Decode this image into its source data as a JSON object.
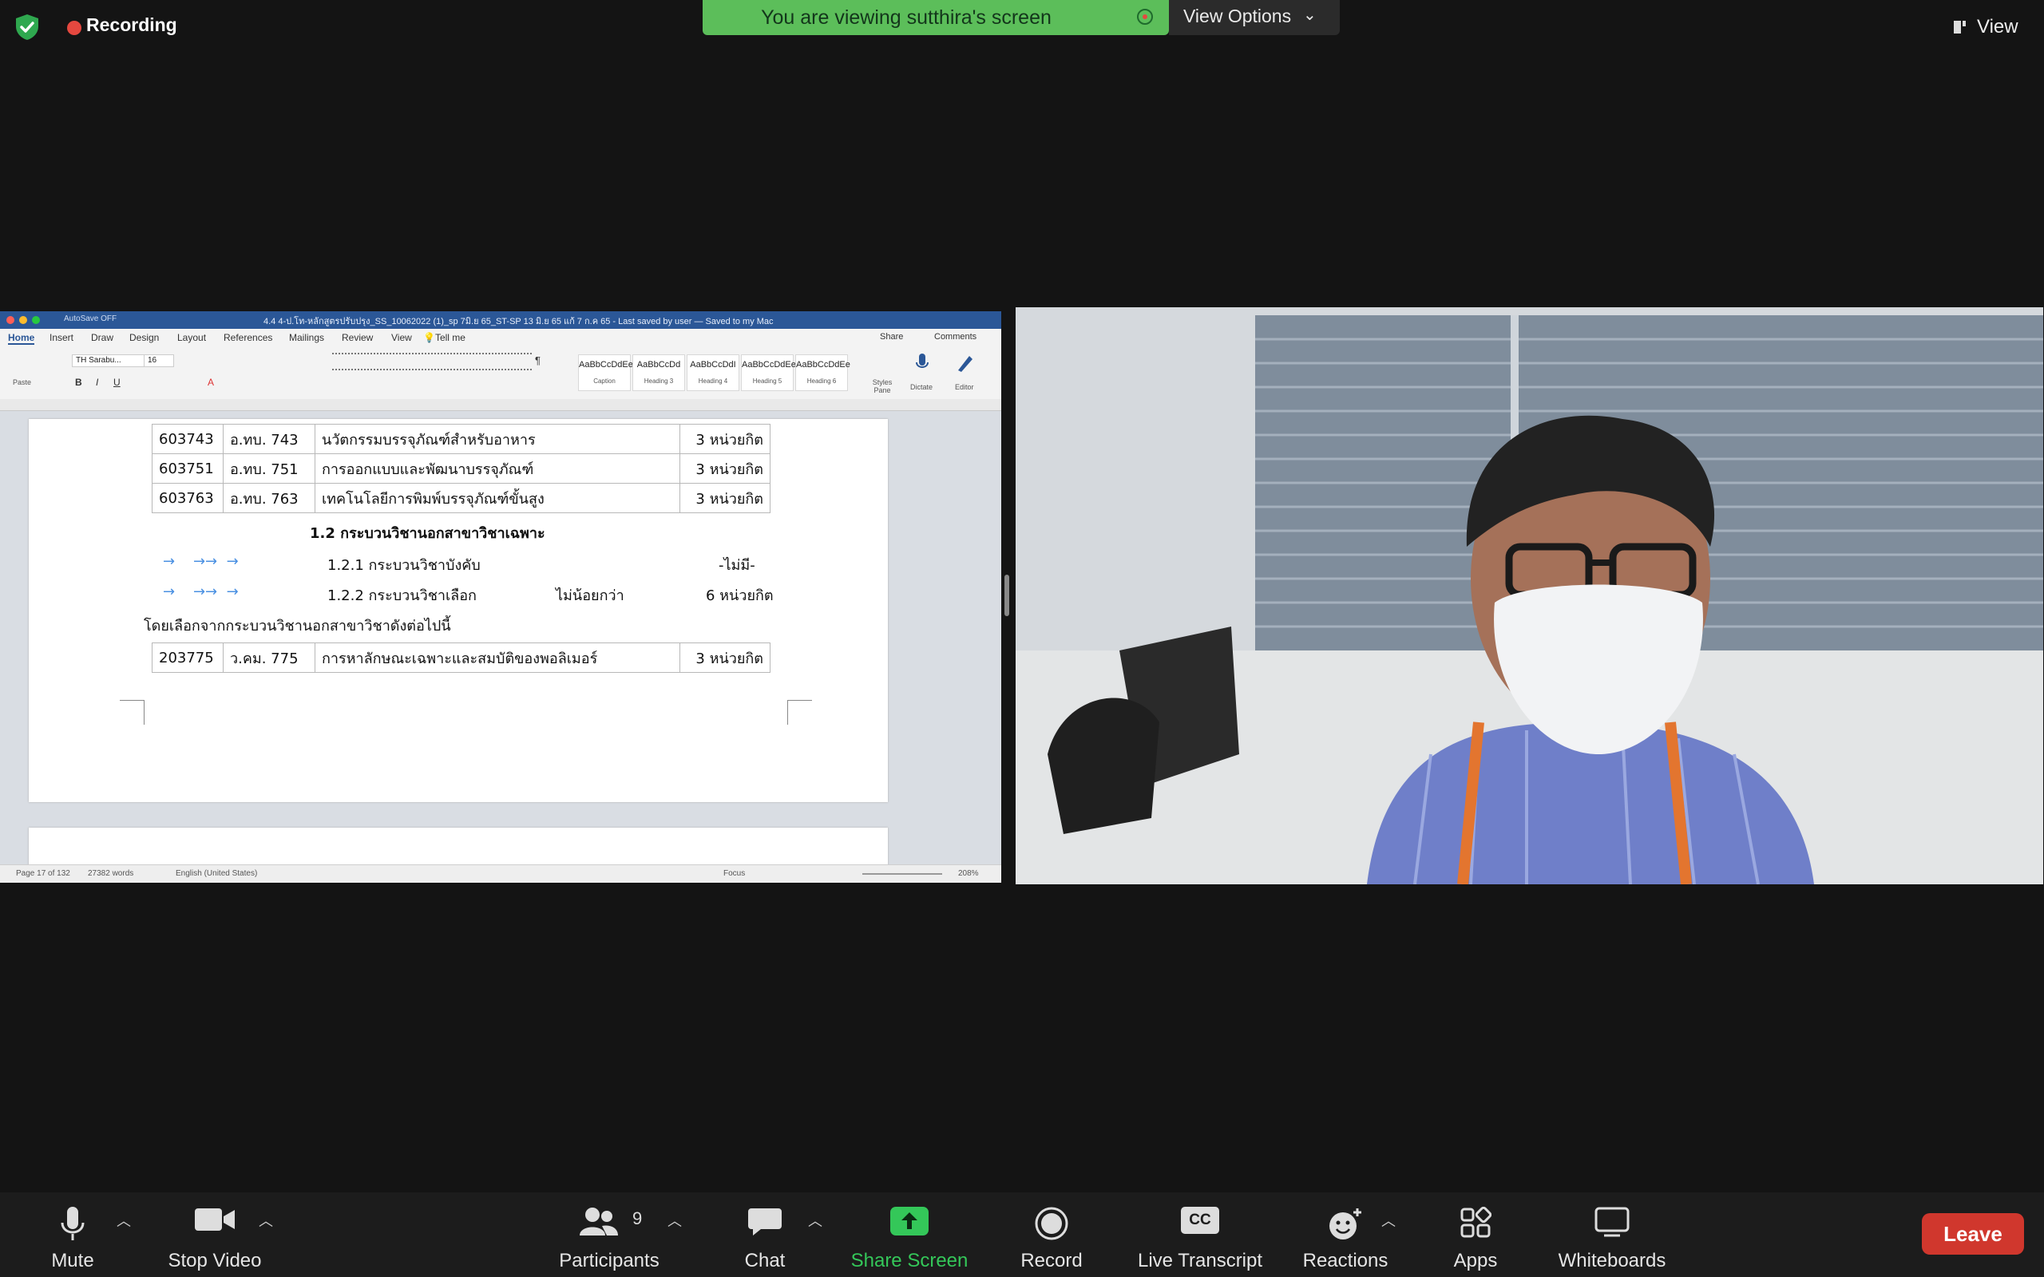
{
  "meeting": {
    "recording_label": "Recording",
    "banner_text": "You are viewing sutthira's screen",
    "view_options_label": "View Options",
    "view_label": "View"
  },
  "word": {
    "autosave": "AutoSave",
    "autosave_state": "OFF",
    "doc_title": "4.4 4-ป.โท-หลักสูตรปรับปรุง_SS_10062022 (1)_sp 7มิ.ย 65_ST-SP 13 มิ.ย 65 แก้ 7 ก.ค 65 - Last saved by user — Saved to my Mac",
    "tabs": [
      "Home",
      "Insert",
      "Draw",
      "Design",
      "Layout",
      "References",
      "Mailings",
      "Review",
      "View",
      "Tell me"
    ],
    "share": "Share",
    "comments": "Comments",
    "font_name": "TH Sarabu...",
    "font_size": "16",
    "styles": [
      {
        "sample": "AaBbCcDdEe",
        "name": "Caption"
      },
      {
        "sample": "AaBbCcDd",
        "name": "Heading 3"
      },
      {
        "sample": "AaBbCcDdI",
        "name": "Heading 4"
      },
      {
        "sample": "AaBbCcDdEe",
        "name": "Heading 5"
      },
      {
        "sample": "AaBbCcDdEe",
        "name": "Heading 6"
      }
    ],
    "styles_pane": "Styles Pane",
    "dictate": "Dictate",
    "editor": "Editor",
    "paste": "Paste",
    "status": {
      "page": "Page 17 of 132",
      "words": "27382 words",
      "language": "English (United States)",
      "focus": "Focus",
      "zoom": "208%"
    },
    "table1": [
      {
        "code": "603743",
        "abbr": "อ.ทบ. 743",
        "name": "นวัตกรรมบรรจุภัณฑ์สำหรับอาหาร",
        "credit": "3 หน่วยกิต"
      },
      {
        "code": "603751",
        "abbr": "อ.ทบ. 751",
        "name": "การออกแบบและพัฒนาบรรจุภัณฑ์",
        "credit": "3 หน่วยกิต"
      },
      {
        "code": "603763",
        "abbr": "อ.ทบ. 763",
        "name": "เทคโนโลยีการพิมพ์บรรจุภัณฑ์ขั้นสูง",
        "credit": "3 หน่วยกิต"
      }
    ],
    "section_heading": "1.2 กระบวนวิชานอกสาขาวิชาเฉพาะ",
    "line_121_label": "1.2.1 กระบวนวิชาบังคับ",
    "line_121_value": "-ไม่มี-",
    "line_122_label": "1.2.2 กระบวนวิชาเลือก",
    "line_122_mid": "ไม่น้อยกว่า",
    "line_122_value": "6 หน่วยกิต",
    "select_sentence": "โดยเลือกจากกระบวนวิชานอกสาขาวิชาดังต่อไปนี้",
    "table2": [
      {
        "code": "203775",
        "abbr": "ว.คม. 775",
        "name": "การหาลักษณะเฉพาะและสมบัติของพอลิเมอร์",
        "credit": "3 หน่วยกิต"
      }
    ]
  },
  "toolbar": {
    "mute": "Mute",
    "stop_video": "Stop Video",
    "participants": "Participants",
    "participants_count": "9",
    "chat": "Chat",
    "share_screen": "Share Screen",
    "record": "Record",
    "live_transcript": "Live Transcript",
    "reactions": "Reactions",
    "apps": "Apps",
    "whiteboards": "Whiteboards",
    "leave": "Leave",
    "cc_badge": "CC",
    "share_color": "#34c759",
    "leave_color": "#d0372d",
    "recording_dot_color": "#e5483f",
    "banner_color": "#5cbe5a"
  }
}
